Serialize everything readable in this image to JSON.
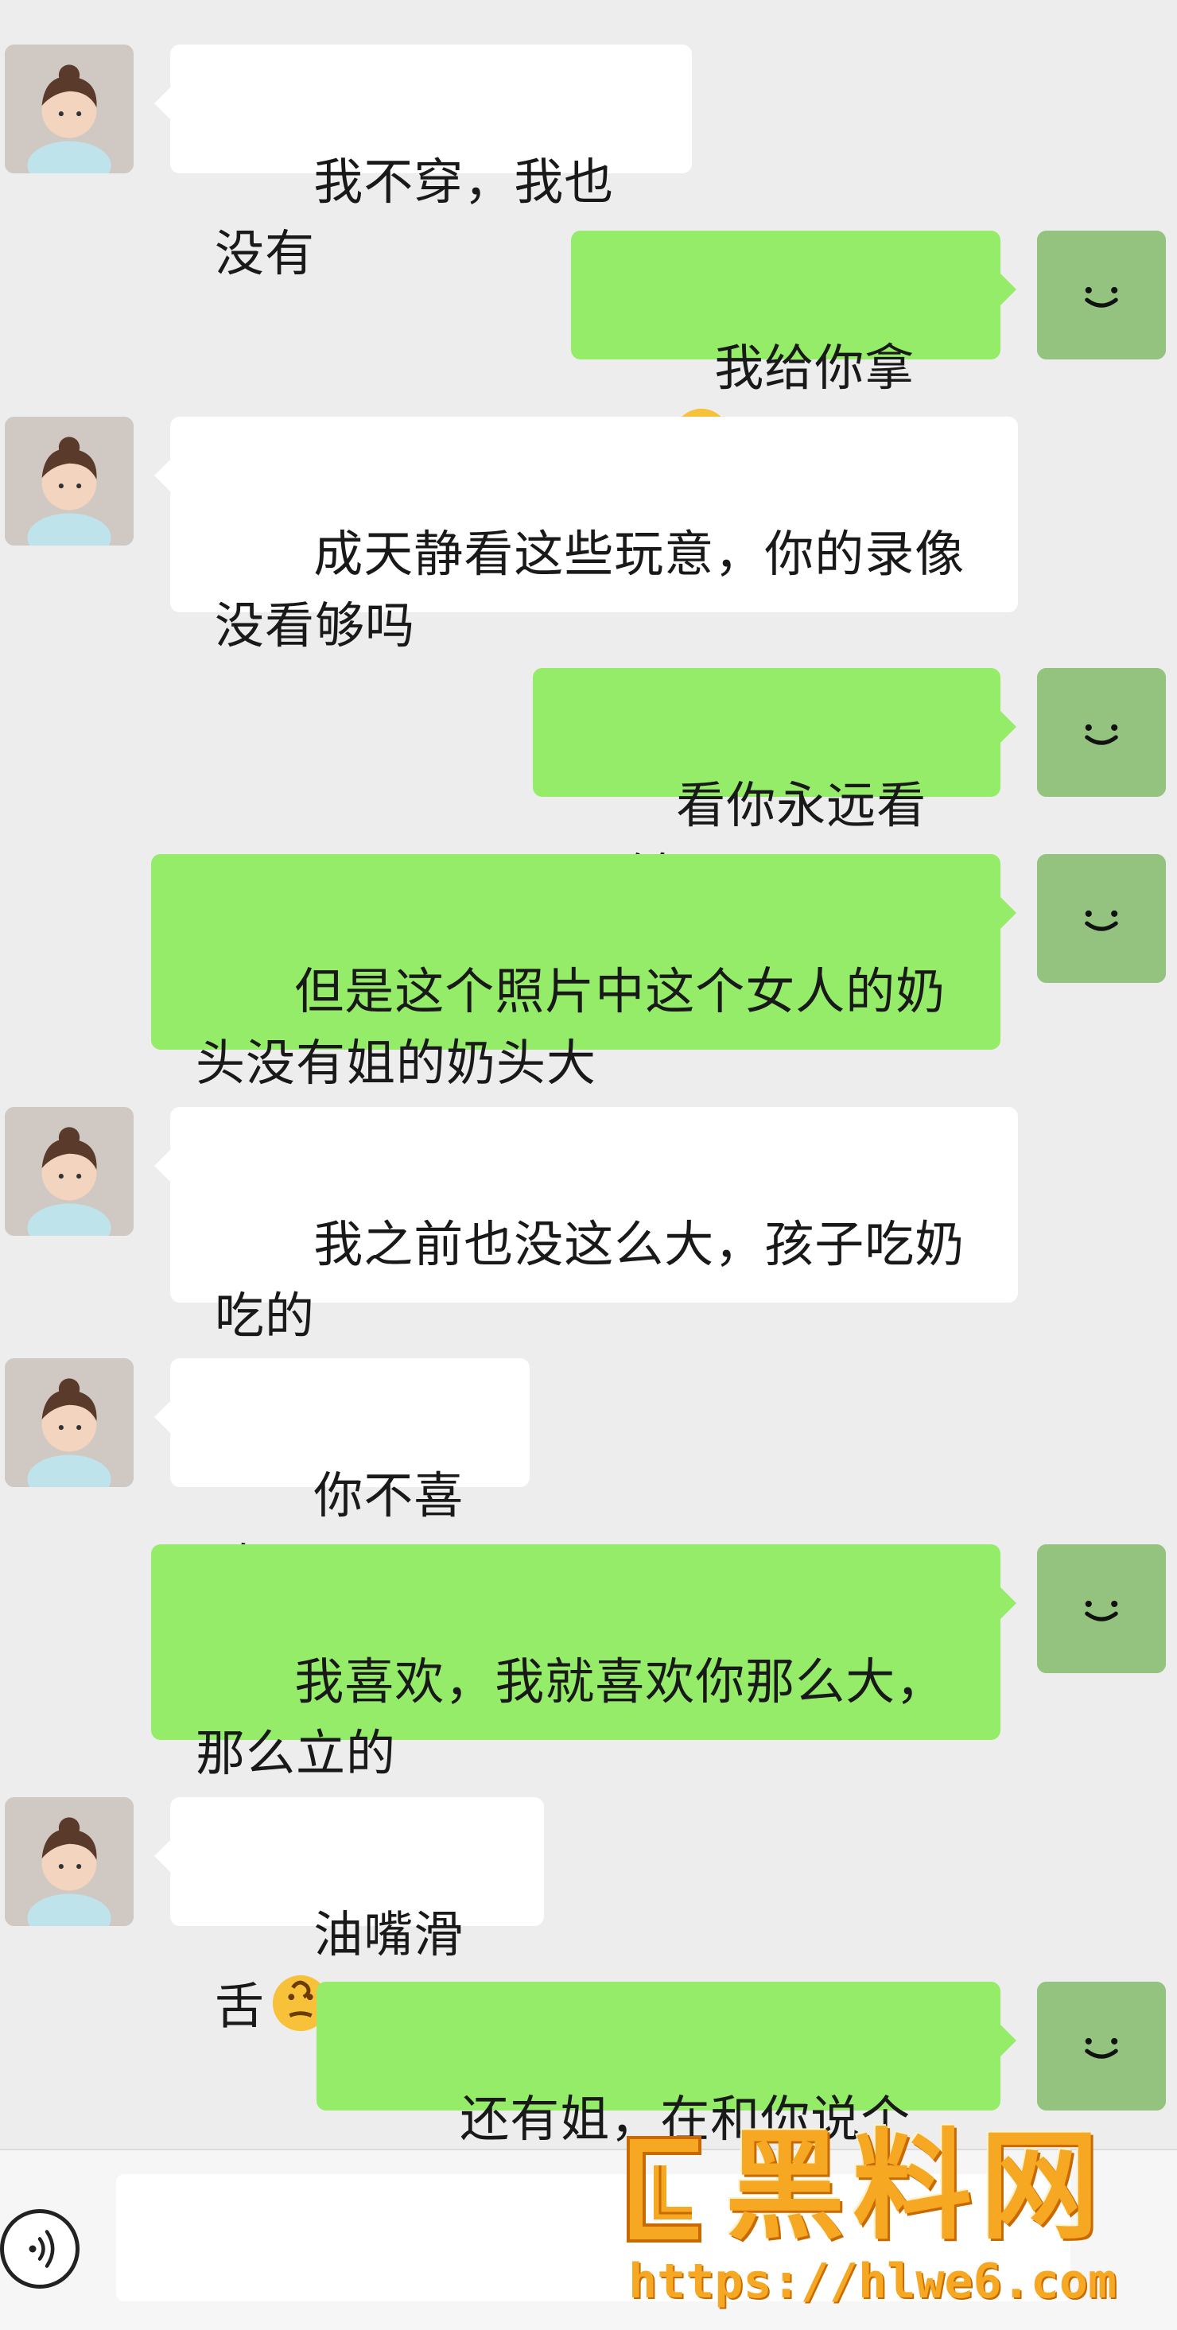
{
  "messages": [
    {
      "side": "left",
      "text": "我不穿，我也没有"
    },
    {
      "side": "right",
      "text": "我给你拿呀",
      "emoji": "heart-eyes-emoji"
    },
    {
      "side": "left",
      "text": "成天静看这些玩意，你的录像没看够吗"
    },
    {
      "side": "right",
      "text": "看你永远看不够"
    },
    {
      "side": "right",
      "text": "但是这个照片中这个女人的奶头没有姐的奶头大"
    },
    {
      "side": "left",
      "text": "我之前也没这么大，孩子吃奶吃的"
    },
    {
      "side": "left",
      "text": "你不喜欢吗"
    },
    {
      "side": "right",
      "text": "我喜欢，我就喜欢你那么大，那么立的"
    },
    {
      "side": "left",
      "text": "油嘴滑舌",
      "emoji": "thinking-emoji"
    },
    {
      "side": "right",
      "text": "还有姐，在和你说个事呗"
    }
  ],
  "watermark": {
    "title": "黑料网",
    "url": "https://hlwe6.com"
  },
  "colors": {
    "background": "#ededed",
    "bubble_right": "#95ec69",
    "bubble_left": "#ffffff",
    "watermark": "#f7a823"
  }
}
